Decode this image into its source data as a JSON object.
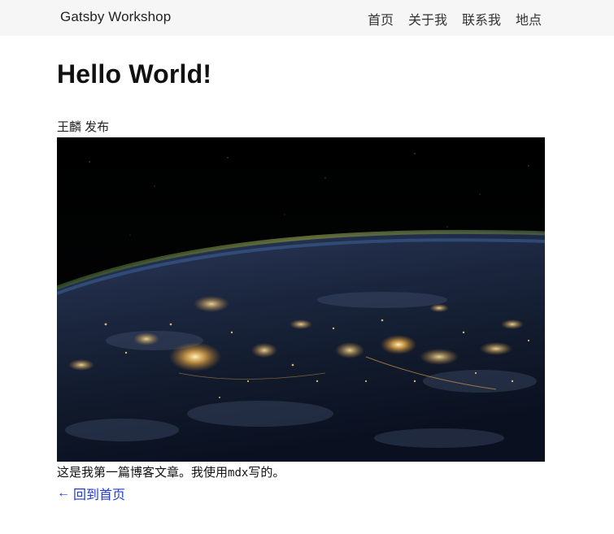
{
  "header": {
    "brand": "Gatsby Workshop",
    "nav": [
      {
        "label": "首页"
      },
      {
        "label": "关于我"
      },
      {
        "label": "联系我"
      },
      {
        "label": "地点"
      }
    ],
    "background": "#f6f6f6"
  },
  "post": {
    "title": "Hello World!",
    "byline": "王麟 发布",
    "image_alt": "Earth at night from space",
    "body_prefix": "这是我第一篇博客文章。我使用",
    "body_code": "mdx",
    "body_suffix": "写的。",
    "back_arrow": "←",
    "back_label": "回到首页"
  },
  "colors": {
    "link": "#1f3ad6",
    "text": "#222222"
  }
}
